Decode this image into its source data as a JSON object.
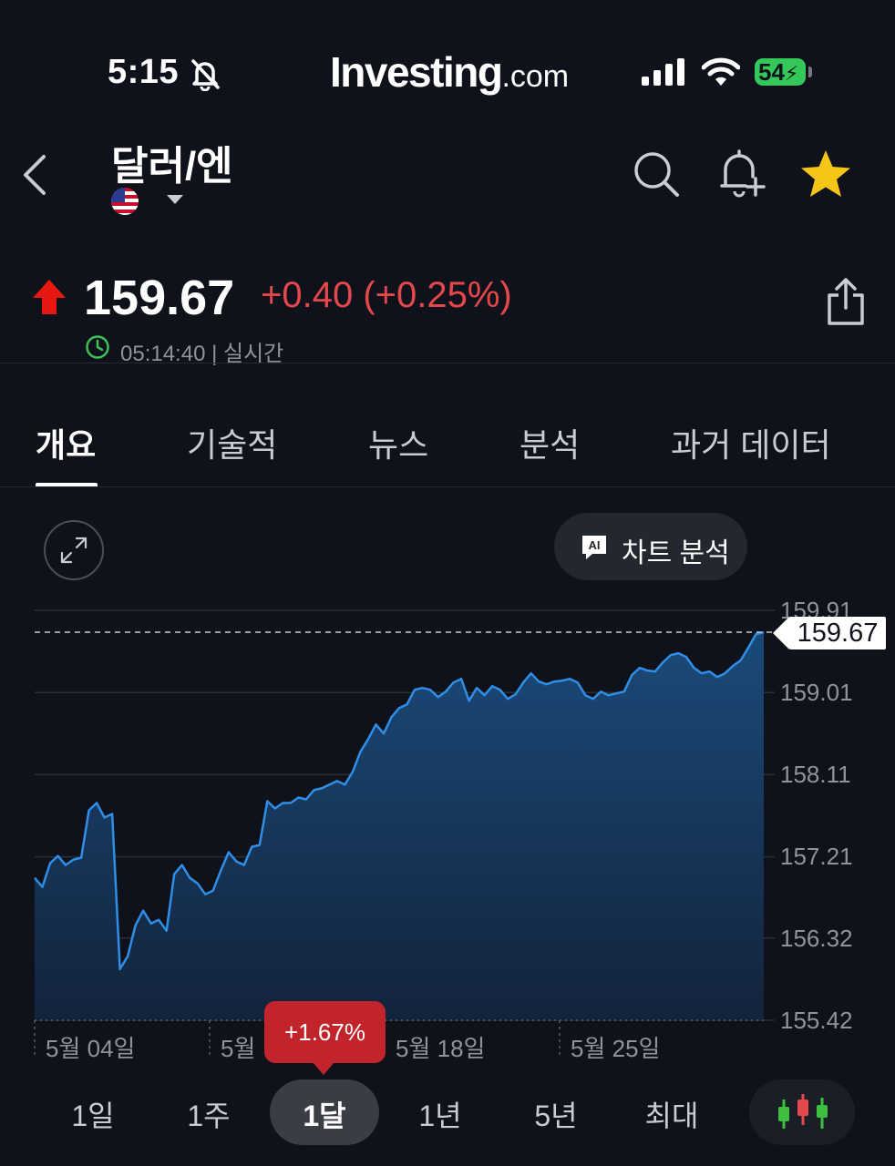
{
  "status_bar": {
    "time": "5:15",
    "brand": "Investing",
    "brand_suffix": ".com",
    "battery": "54"
  },
  "header": {
    "title": "달러/엔"
  },
  "quote": {
    "price": "159.67",
    "change": "+0.40 (+0.25%)",
    "timestamp": "05:14:40 | 실시간",
    "direction": "up",
    "up_color": "#e4484c"
  },
  "tabs": [
    {
      "label": "개요",
      "active": true
    },
    {
      "label": "기술적"
    },
    {
      "label": "뉴스"
    },
    {
      "label": "분석"
    },
    {
      "label": "과거 데이터"
    }
  ],
  "chart_controls": {
    "ai_label": "차트 분석"
  },
  "chart_data": {
    "type": "area",
    "y_ticks": [
      "159.91",
      "159.01",
      "158.11",
      "157.21",
      "156.32",
      "155.42"
    ],
    "ylim": [
      155.42,
      159.91
    ],
    "x_ticks": [
      "5월 04일",
      "5월",
      "5월 18일",
      "5월 25일"
    ],
    "current_value": "159.67",
    "line_color": "#2f8fe8",
    "values": [
      156.98,
      156.88,
      157.14,
      157.22,
      157.12,
      157.18,
      157.2,
      157.72,
      157.8,
      157.64,
      157.68,
      155.98,
      156.12,
      156.46,
      156.62,
      156.48,
      156.52,
      156.4,
      157.02,
      157.12,
      156.98,
      156.92,
      156.8,
      156.84,
      157.06,
      157.26,
      157.16,
      157.12,
      157.32,
      157.34,
      157.82,
      157.74,
      157.8,
      157.8,
      157.86,
      157.84,
      157.94,
      157.96,
      158.0,
      158.04,
      158.0,
      158.14,
      158.36,
      158.5,
      158.66,
      158.56,
      158.74,
      158.84,
      158.88,
      159.04,
      159.06,
      159.04,
      158.96,
      159.02,
      159.12,
      159.16,
      158.92,
      159.06,
      158.98,
      159.08,
      159.04,
      158.94,
      158.99,
      159.12,
      159.22,
      159.13,
      159.1,
      159.13,
      159.14,
      159.16,
      159.12,
      158.98,
      158.94,
      159.02,
      158.98,
      159.0,
      159.02,
      159.2,
      159.28,
      159.25,
      159.24,
      159.34,
      159.42,
      159.44,
      159.4,
      159.28,
      159.22,
      159.24,
      159.18,
      159.22,
      159.3,
      159.36,
      159.5,
      159.65,
      159.67
    ],
    "change_label": "+1.67%"
  },
  "periods": [
    {
      "label": "1일"
    },
    {
      "label": "1주"
    },
    {
      "label": "1달",
      "active": true
    },
    {
      "label": "1년"
    },
    {
      "label": "5년"
    },
    {
      "label": "최대"
    }
  ],
  "icons": [
    "back-chevron-icon",
    "search-icon",
    "bell-plus-icon",
    "star-icon",
    "share-icon",
    "clock-icon",
    "expand-icon",
    "ai-icon",
    "candlestick-icon",
    "mute-bell-icon",
    "signal-icon",
    "wifi-icon"
  ]
}
